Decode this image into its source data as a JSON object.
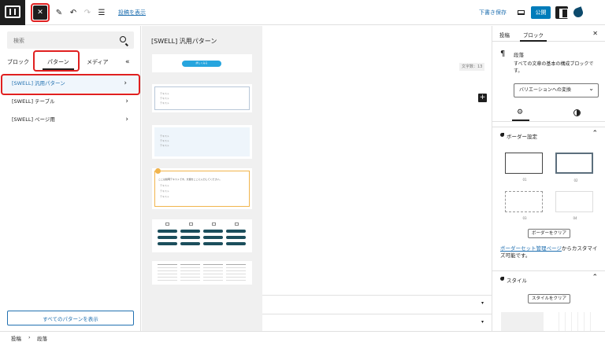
{
  "topbar": {
    "logo_text": "WordPress",
    "posts_link": "投稿を表示",
    "save_draft": "下書き保存",
    "publish": "公開"
  },
  "inserter": {
    "search_placeholder": "検索",
    "tabs": [
      {
        "label": "ブロック",
        "active": false
      },
      {
        "label": "パターン",
        "active": true
      },
      {
        "label": "メディア",
        "active": false
      }
    ],
    "categories": [
      {
        "label": "[SWELL] 汎用パターン",
        "active": true
      },
      {
        "label": "[SWELL] テーブル",
        "active": false
      },
      {
        "label": "[SWELL] ページ用",
        "active": false
      }
    ],
    "show_all": "すべてのパターンを表示"
  },
  "patterns": {
    "title": "[SWELL] 汎用パターン",
    "button_label": "詳しくみる",
    "box_caption": "ここは説明テキストです。文章をここに入力してください。",
    "list_item": "テキスト"
  },
  "canvas": {
    "char_count": "文字数：13"
  },
  "settings": {
    "tabs": [
      {
        "label": "投稿",
        "active": false
      },
      {
        "label": "ブロック",
        "active": true
      }
    ],
    "block_name": "段落",
    "block_desc": "すべての文章の基本の構成ブロックです。",
    "variation": "バリエーションへの変換",
    "border_section": "ボーダー設定",
    "border_options": [
      "01",
      "02",
      "03",
      "04"
    ],
    "clear_border": "ボーダーをクリア",
    "note_link": "ボーダーセット管理ページ",
    "note_text": "からカスタマイズ可能です。",
    "style_section": "スタイル",
    "clear_style": "スタイルをクリア"
  },
  "footer": {
    "crumb_root": "投稿",
    "crumb_sep": "›",
    "crumb_current": "段落"
  }
}
